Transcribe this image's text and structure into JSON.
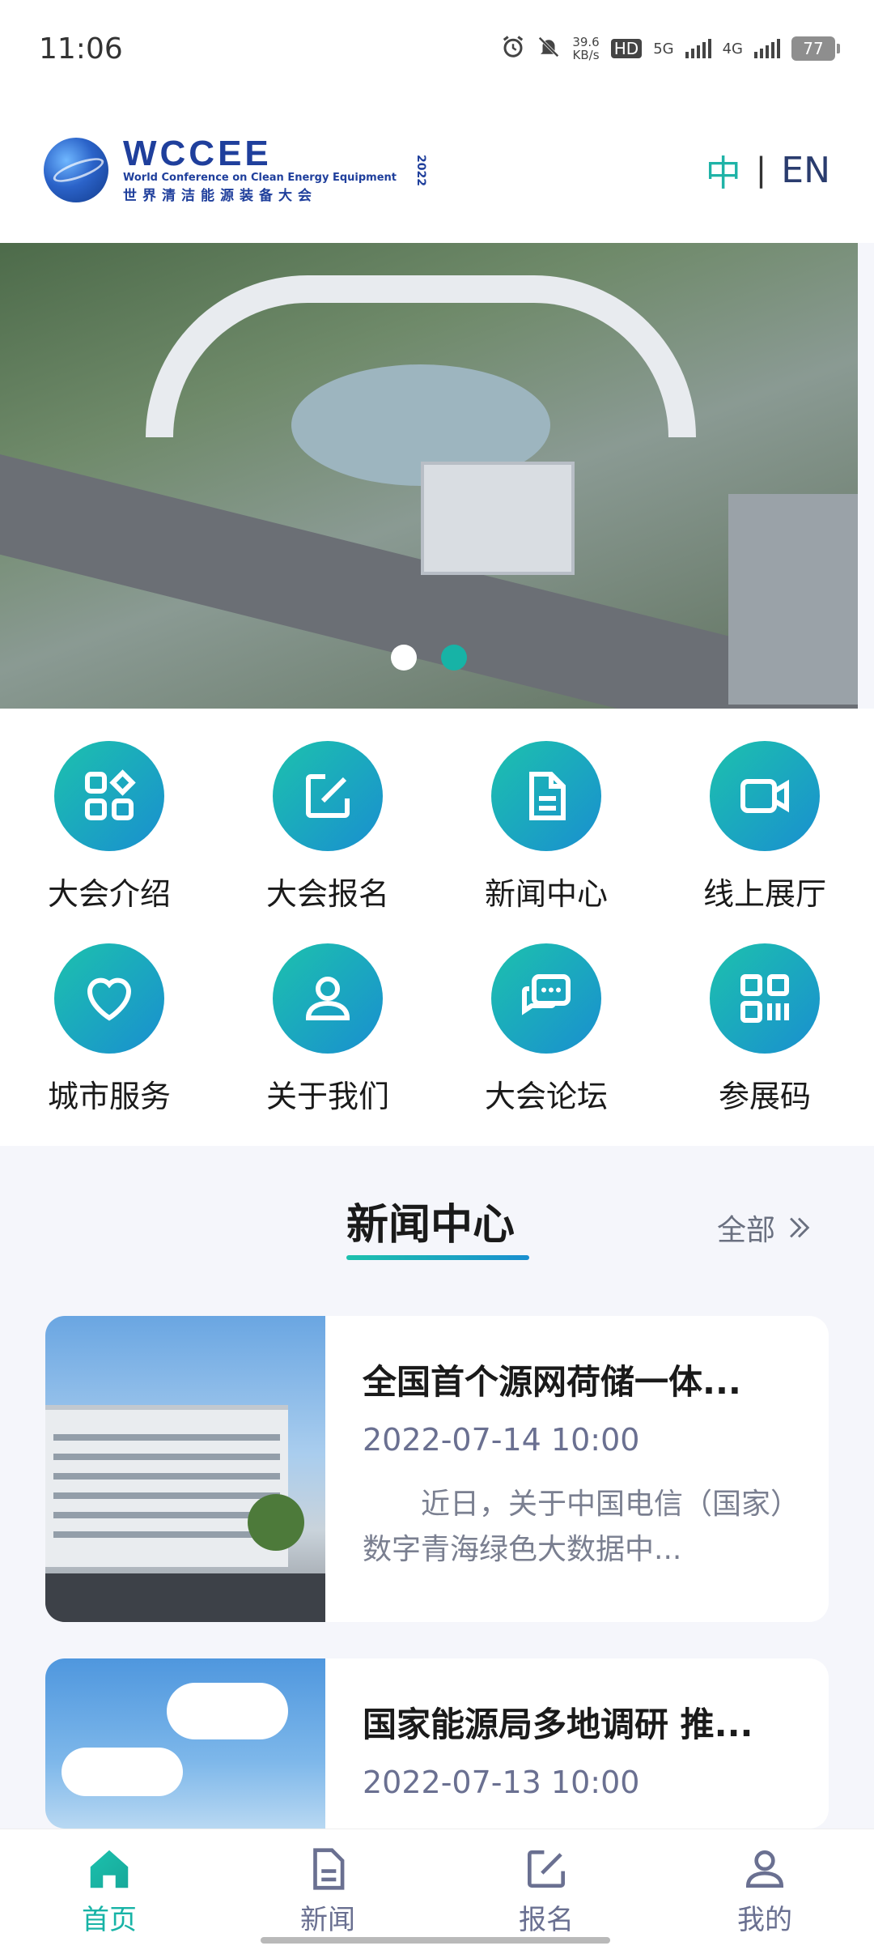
{
  "status_bar": {
    "time": "11:06",
    "speed_value": "39.6",
    "speed_unit": "KB/s",
    "hd_label": "HD",
    "net1": "5G",
    "net2": "4G",
    "battery": "77"
  },
  "header": {
    "logo_wordmark": "WCCEE",
    "logo_en": "World Conference on Clean Energy Equipment",
    "logo_cn": "世界清洁能源装备大会",
    "logo_year": "2022",
    "lang_zh": "中",
    "lang_sep": "|",
    "lang_en": "EN"
  },
  "banner": {
    "slide_count": 2,
    "active_index": 1
  },
  "grid": {
    "items": [
      {
        "label": "大会介绍",
        "icon": "apps-icon"
      },
      {
        "label": "大会报名",
        "icon": "edit-icon"
      },
      {
        "label": "新闻中心",
        "icon": "document-icon"
      },
      {
        "label": "线上展厅",
        "icon": "video-icon"
      },
      {
        "label": "城市服务",
        "icon": "heart-icon"
      },
      {
        "label": "关于我们",
        "icon": "user-icon"
      },
      {
        "label": "大会论坛",
        "icon": "chat-icon"
      },
      {
        "label": "参展码",
        "icon": "qrcode-icon"
      }
    ]
  },
  "news": {
    "section_title": "新闻中心",
    "all_label": "全部",
    "items": [
      {
        "headline": "全国首个源网荷储一体...",
        "date": "2022-07-14 10:00",
        "excerpt": "近日，关于中国电信（国家）数字青海绿色大数据中..."
      },
      {
        "headline": "国家能源局多地调研 推...",
        "date": "2022-07-13 10:00"
      }
    ]
  },
  "tabbar": {
    "tabs": [
      {
        "label": "首页",
        "icon": "home-icon",
        "active": true
      },
      {
        "label": "新闻",
        "icon": "news-icon",
        "active": false
      },
      {
        "label": "报名",
        "icon": "signup-icon",
        "active": false
      },
      {
        "label": "我的",
        "icon": "profile-icon",
        "active": false
      }
    ]
  },
  "colors": {
    "accent": "#17b3a6",
    "brand_blue": "#1f3f9c",
    "gradient_start": "#1cc1ad",
    "gradient_end": "#1a8fd0"
  }
}
